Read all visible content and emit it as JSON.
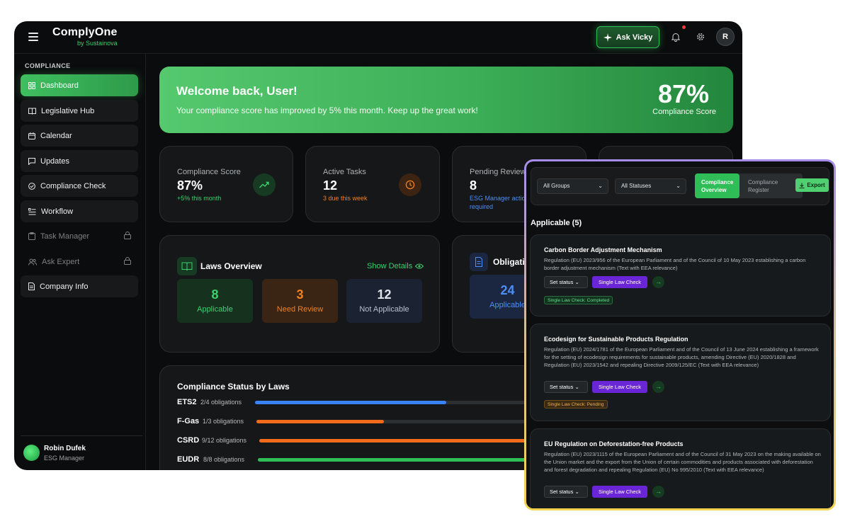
{
  "brand": {
    "name": "ComplyOne",
    "sub": "by Sustainova"
  },
  "header": {
    "ask_label": "Ask Vicky",
    "avatar_initial": "R"
  },
  "sidebar": {
    "section": "COMPLIANCE",
    "items": [
      {
        "label": "Dashboard",
        "icon": "grid-icon",
        "active": true
      },
      {
        "label": "Legislative Hub",
        "icon": "book-icon"
      },
      {
        "label": "Calendar",
        "icon": "calendar-icon"
      },
      {
        "label": "Updates",
        "icon": "message-icon"
      },
      {
        "label": "Compliance Check",
        "icon": "check-circle-icon"
      },
      {
        "label": "Workflow",
        "icon": "list-icon"
      },
      {
        "label": "Task Manager",
        "icon": "clipboard-icon",
        "locked": true
      },
      {
        "label": "Ask Expert",
        "icon": "users-icon",
        "locked": true
      },
      {
        "label": "Company Info",
        "icon": "document-icon"
      }
    ],
    "user": {
      "name": "Robin Dufek",
      "role": "ESG Manager"
    }
  },
  "welcome": {
    "title": "Welcome back, User!",
    "message": "Your compliance score has improved by 5% this month. Keep up the great work!",
    "score": "87%",
    "score_label": "Compliance Score"
  },
  "stats": [
    {
      "label": "Compliance Score",
      "value": "87%",
      "sub": "+5% this month"
    },
    {
      "label": "Active Tasks",
      "value": "12",
      "sub": "3 due this week"
    },
    {
      "label": "Pending Review",
      "value": "8",
      "sub": "ESG Manager action",
      "sub2": "required"
    }
  ],
  "laws_overview": {
    "title": "Laws Overview",
    "show_details": "Show Details",
    "boxes": [
      {
        "num": "8",
        "label": "Applicable"
      },
      {
        "num": "3",
        "label": "Need Review"
      },
      {
        "num": "12",
        "label": "Not Applicable"
      }
    ]
  },
  "obligations": {
    "title": "Obligati",
    "num": "24",
    "label": "Applicable"
  },
  "status_by_laws": {
    "title": "Compliance Status by Laws",
    "rows": [
      {
        "name": "ETS2",
        "obligations": "2/4 obligations",
        "fraction": 0.5,
        "color": "#3a82f7"
      },
      {
        "name": "F-Gas",
        "obligations": "1/3 obligations",
        "fraction": 0.333,
        "color": "#f26a1b"
      },
      {
        "name": "CSRD",
        "obligations": "9/12 obligations",
        "fraction": 0.75,
        "color": "#f26a1b"
      },
      {
        "name": "EUDR",
        "obligations": "8/8 obligations",
        "fraction": 1.0,
        "color": "#2ebd56"
      }
    ]
  },
  "panel": {
    "group_filter": "All Groups",
    "status_filter": "All Statuses",
    "seg_on": [
      "Compliance",
      "Overview"
    ],
    "seg_off": [
      "Compliance",
      "Register"
    ],
    "export_label": "Export",
    "applicable_heading": "Applicable (5)",
    "set_status_label": "Set status",
    "slc_label": "Single Law Check",
    "laws": [
      {
        "title": "Carbon Border Adjustment Mechanism",
        "desc": "Regulation (EU) 2023/956 of the European Parliament and of the Council of 10 May 2023 establishing a carbon border adjustment mechanism (Text with EEA relevance)",
        "badge": "Single Law Check: Completed"
      },
      {
        "title": "Ecodesign for Sustainable Products Regulation",
        "desc": "Regulation (EU) 2024/1781 of the European Parliament and of the Council of 13 June 2024 establishing a framework for the setting of ecodesign requirements for sustainable products, amending Directive (EU) 2020/1828 and Regulation (EU) 2023/1542 and repealing Directive 2009/125/EC (Text with EEA relevance)",
        "badge": "Single Law Check: Pending"
      },
      {
        "title": "EU Regulation on Deforestation-free Products",
        "desc": "Regulation (EU) 2023/1115 of the European Parliament and of the Council of 31 May 2023 on the making available on the Union market and the export from the Union of certain commodities and products associated with deforestation and forest degradation and repealing Regulation (EU) No 995/2010 (Text with EEA relevance)",
        "badge": ""
      }
    ]
  },
  "colors": {
    "accent": "#2ebd56",
    "purple": "#6a25d6",
    "orange": "#f26a1b",
    "blue": "#3a82f7"
  }
}
